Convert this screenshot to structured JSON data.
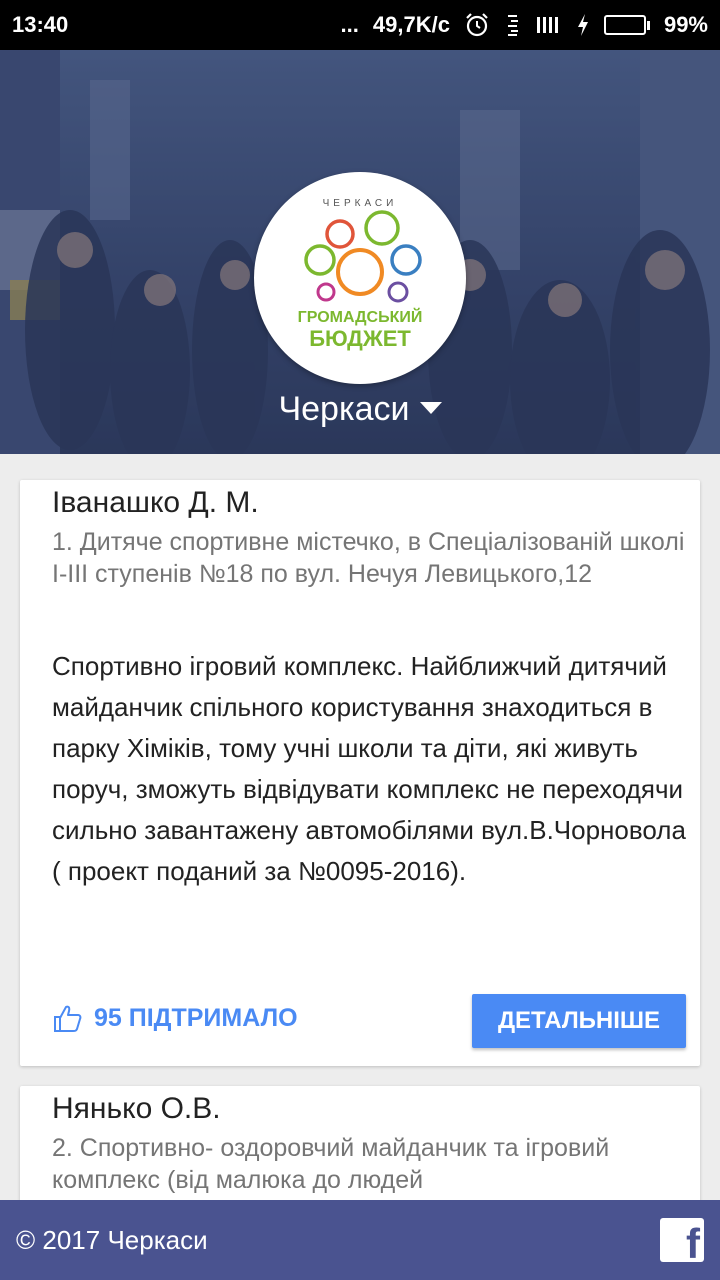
{
  "status_bar": {
    "time": "13:40",
    "dots": "...",
    "network_speed": "49,7K/c",
    "battery_percent": "99%",
    "battery_level": 0.99
  },
  "hero": {
    "logo": {
      "top_text": "ЧЕРКАСИ",
      "line1": "ГРОМАДСЬКИЙ",
      "line2": "БЮДЖЕТ"
    },
    "city": "Черкаси"
  },
  "projects": [
    {
      "author": "Іванашко Д. М.",
      "title": "1. Дитяче спортивне містечко, в Спеціалізованій школі І-ІІІ ступенів №18 по вул. Нечуя Левицького,12",
      "description": "Спортивно ігровий комплекс. Найближчий дитячий майданчик спільного користування знаходиться в парку Хіміків, тому учні школи та діти, які живуть поруч, зможуть відвідувати комплекс не переходячи сильно завантажену автомобілями вул.В.Чорновола ( проект поданий за №0095-2016).",
      "likes_label": "95 ПІДТРИМАЛО",
      "more_label": "ДЕТАЛЬНІШЕ"
    },
    {
      "author": "Нянько О.В.",
      "title": "2. Спортивно- оздоровчий майданчик та ігровий комплекс (від малюка до людей"
    }
  ],
  "footer": {
    "copyright": "© 2017 Черкаси",
    "facebook_icon": "facebook-icon"
  },
  "colors": {
    "accent": "#4a8af4",
    "footer": "#4a5390",
    "logo_green": "#7cb82f"
  }
}
